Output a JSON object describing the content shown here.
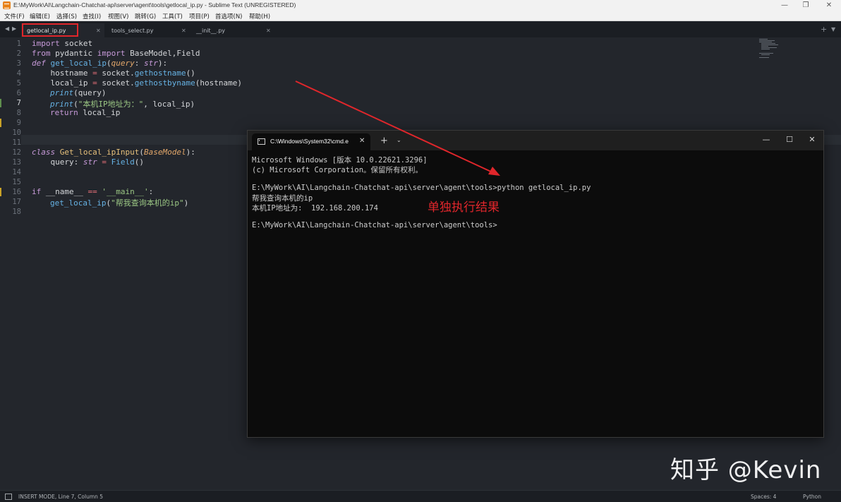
{
  "window": {
    "title": "E:\\MyWork\\AI\\Langchain-Chatchat-api\\server\\agent\\tools\\getlocal_ip.py - Sublime Text (UNREGISTERED)",
    "minimize": "—",
    "maximize": "❐",
    "close": "✕"
  },
  "menu": [
    "文件(F)",
    "编辑(E)",
    "选择(S)",
    "查找(I)",
    "视图(V)",
    "跳转(G)",
    "工具(T)",
    "项目(P)",
    "首选项(N)",
    "帮助(H)"
  ],
  "tabs": [
    {
      "label": "getlocal_ip.py",
      "active": true
    },
    {
      "label": "tools_select.py",
      "active": false
    },
    {
      "label": "__init__.py",
      "active": false
    }
  ],
  "tab_controls": {
    "close": "✕",
    "plus": "+",
    "more": "▼",
    "back": "◀",
    "forward": "▶"
  },
  "editor": {
    "line_numbers": [
      "1",
      "2",
      "3",
      "4",
      "5",
      "6",
      "7",
      "8",
      "9",
      "10",
      "11",
      "12",
      "13",
      "14",
      "15",
      "16",
      "17",
      "18"
    ],
    "current_line": "7",
    "code": {
      "l1_kw": "import",
      "l1_rest": " socket",
      "l2_kw1": "from",
      "l2_mid": " pydantic ",
      "l2_kw2": "import",
      "l2_rest": " BaseModel,Field",
      "l3_def": "def",
      "l3_fn": "get_local_ip",
      "l3_p1": "(",
      "l3_par": "query",
      "l3_colon": ": ",
      "l3_typ": "str",
      "l3_end": "):",
      "l4_a": "    hostname ",
      "l4_eq": "=",
      "l4_b": " socket.",
      "l4_fn": "gethostname",
      "l4_c": "()",
      "l5_a": "    local_ip ",
      "l5_eq": "=",
      "l5_b": " socket.",
      "l5_fn": "gethostbyname",
      "l5_c": "(hostname)",
      "l6_fn": "print",
      "l6_rest": "(query)",
      "l7_fn": "print",
      "l7_p": "(",
      "l7_str": "\"本机IP地址为：\"",
      "l7_rest": ", local_ip)",
      "l8_kw": "return",
      "l8_rest": " local_ip",
      "l12_cls": "class",
      "l12_name": "Get_local_ipInput",
      "l12_p": "(",
      "l12_base": "BaseModel",
      "l12_end": "):",
      "l13_a": "    query: ",
      "l13_typ": "str",
      "l13_eq": " = ",
      "l13_fn": "Field",
      "l13_c": "()",
      "l16_kw": "if",
      "l16_a": " __name__ ",
      "l16_eq": "==",
      "l16_sp": " ",
      "l16_str": "'__main__'",
      "l16_end": ":",
      "l17_fn": "get_local_ip",
      "l17_p": "(",
      "l17_str": "\"帮我查询本机的ip\"",
      "l17_end": ")"
    }
  },
  "cmd": {
    "tab_title": "C:\\Windows\\System32\\cmd.e",
    "tab_close": "✕",
    "new_tab": "+",
    "dropdown": "⌄",
    "minimize": "—",
    "maximize": "☐",
    "close": "✕",
    "lines": [
      "Microsoft Windows [版本 10.0.22621.3296]",
      "(c) Microsoft Corporation。保留所有权利。",
      "",
      "E:\\MyWork\\AI\\Langchain-Chatchat-api\\server\\agent\\tools>python getlocal_ip.py",
      "帮我查询本机的ip",
      "本机IP地址为:  192.168.200.174",
      "",
      "E:\\MyWork\\AI\\Langchain-Chatchat-api\\server\\agent\\tools>"
    ]
  },
  "annotation": {
    "label": "单独执行结果",
    "color": "#e0262b"
  },
  "watermark": "知乎 @Kevin",
  "status": {
    "mode": "INSERT MODE, Line 7, Column 5",
    "spaces": "Spaces: 4",
    "syntax": "Python"
  }
}
